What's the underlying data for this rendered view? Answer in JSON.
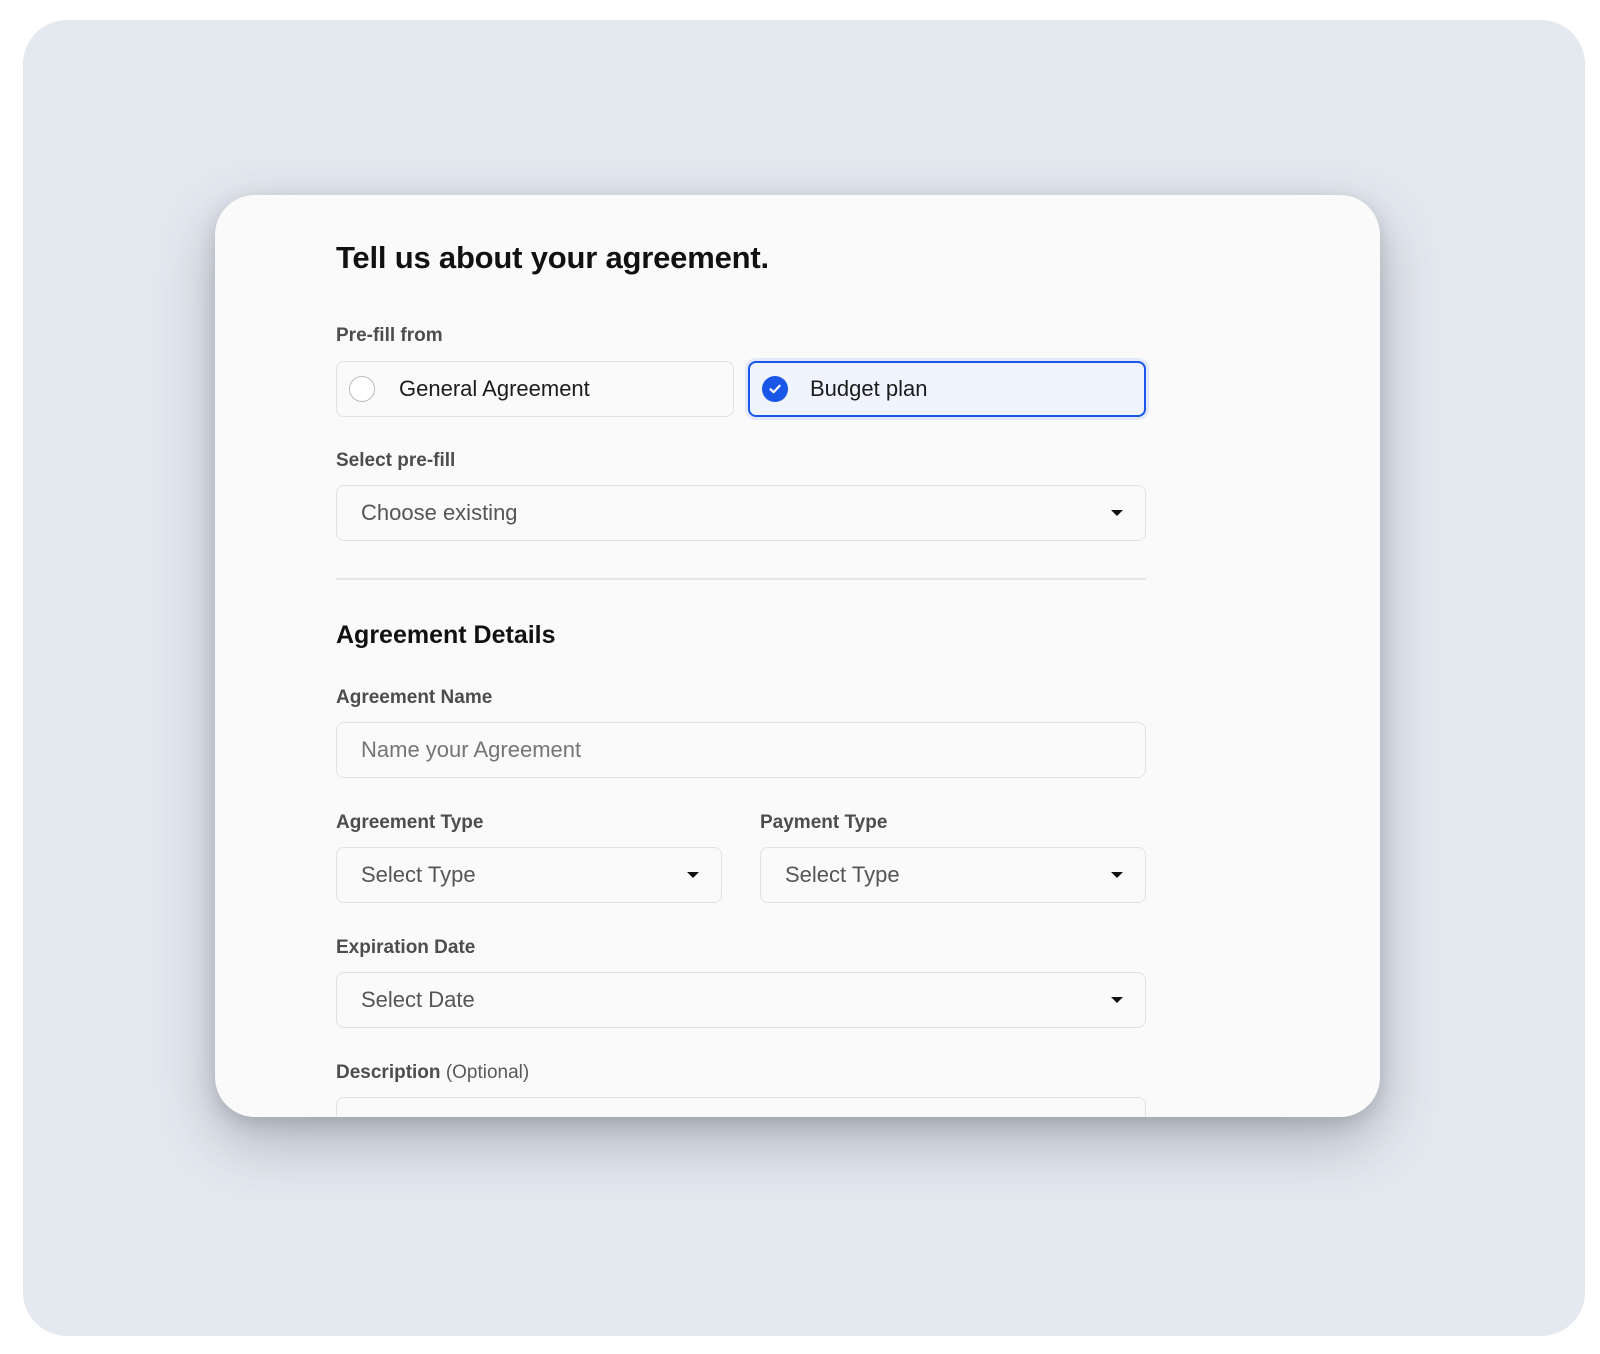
{
  "form": {
    "title": "Tell us about your agreement.",
    "prefill_label": "Pre-fill from",
    "prefill_options": [
      {
        "label": "General Agreement",
        "selected": false
      },
      {
        "label": "Budget plan",
        "selected": true
      }
    ],
    "select_prefill_label": "Select pre-fill",
    "select_prefill_placeholder": "Choose existing",
    "section_title": "Agreement Details",
    "agreement_name_label": "Agreement Name",
    "agreement_name_placeholder": "Name your Agreement",
    "agreement_type_label": "Agreement Type",
    "agreement_type_placeholder": "Select Type",
    "payment_type_label": "Payment Type",
    "payment_type_placeholder": "Select Type",
    "expiration_label": "Expiration Date",
    "expiration_placeholder": "Select Date",
    "description_label": "Description",
    "description_optional": "(Optional)"
  },
  "colors": {
    "accent": "#1a56e8",
    "backdrop": "#e4e8ef",
    "card": "#fafafa"
  },
  "icons": [
    "radio-empty-icon",
    "check-circle-icon",
    "caret-down-icon"
  ]
}
